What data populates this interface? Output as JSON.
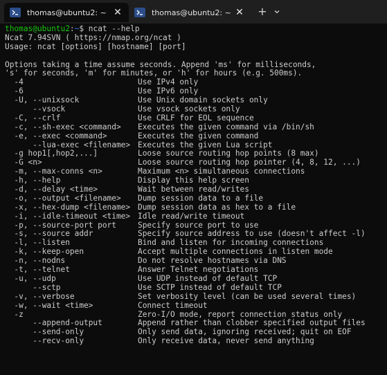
{
  "tabs": [
    {
      "title": "thomas@ubuntu2: ~",
      "close_glyph": "✕",
      "icon": "linux-terminal-icon",
      "active": true
    },
    {
      "title": "thomas@ubuntu2: ~",
      "close_glyph": "✕",
      "icon": "linux-terminal-icon",
      "active": false
    }
  ],
  "titlebar": {
    "new_tab_glyph": "+",
    "dropdown_icon": "chevron-down-icon"
  },
  "terminal": {
    "prompt": {
      "user_host": "thomas@ubuntu2",
      "separator": ":",
      "path": "~",
      "symbol": "$",
      "command": "ncat --help"
    },
    "header_lines": [
      "Ncat 7.94SVN ( https://nmap.org/ncat )",
      "Usage: ncat [options] [hostname] [port]"
    ],
    "intro_lines": [
      "Options taking a time assume seconds. Append 'ms' for milliseconds,",
      "'s' for seconds, 'm' for minutes, or 'h' for hours (e.g. 500ms)."
    ],
    "options": [
      {
        "opt": "  -4",
        "desc": "Use IPv4 only"
      },
      {
        "opt": "  -6",
        "desc": "Use IPv6 only"
      },
      {
        "opt": "  -U, --unixsock",
        "desc": "Use Unix domain sockets only"
      },
      {
        "opt": "      --vsock",
        "desc": "Use vsock sockets only"
      },
      {
        "opt": "  -C, --crlf",
        "desc": "Use CRLF for EOL sequence"
      },
      {
        "opt": "  -c, --sh-exec <command>",
        "desc": "Executes the given command via /bin/sh"
      },
      {
        "opt": "  -e, --exec <command>",
        "desc": "Executes the given command"
      },
      {
        "opt": "      --lua-exec <filename>",
        "desc": "Executes the given Lua script"
      },
      {
        "opt": "  -g hop1[,hop2,...]",
        "desc": "Loose source routing hop points (8 max)"
      },
      {
        "opt": "  -G <n>",
        "desc": "Loose source routing hop pointer (4, 8, 12, ...)"
      },
      {
        "opt": "  -m, --max-conns <n>",
        "desc": "Maximum <n> simultaneous connections"
      },
      {
        "opt": "  -h, --help",
        "desc": "Display this help screen"
      },
      {
        "opt": "  -d, --delay <time>",
        "desc": "Wait between read/writes"
      },
      {
        "opt": "  -o, --output <filename>",
        "desc": "Dump session data to a file"
      },
      {
        "opt": "  -x, --hex-dump <filename>",
        "desc": "Dump session data as hex to a file"
      },
      {
        "opt": "  -i, --idle-timeout <time>",
        "desc": "Idle read/write timeout"
      },
      {
        "opt": "  -p, --source-port port",
        "desc": "Specify source port to use"
      },
      {
        "opt": "  -s, --source addr",
        "desc": "Specify source address to use (doesn't affect -l)"
      },
      {
        "opt": "  -l, --listen",
        "desc": "Bind and listen for incoming connections"
      },
      {
        "opt": "  -k, --keep-open",
        "desc": "Accept multiple connections in listen mode"
      },
      {
        "opt": "  -n, --nodns",
        "desc": "Do not resolve hostnames via DNS"
      },
      {
        "opt": "  -t, --telnet",
        "desc": "Answer Telnet negotiations"
      },
      {
        "opt": "  -u, --udp",
        "desc": "Use UDP instead of default TCP"
      },
      {
        "opt": "      --sctp",
        "desc": "Use SCTP instead of default TCP"
      },
      {
        "opt": "  -v, --verbose",
        "desc": "Set verbosity level (can be used several times)"
      },
      {
        "opt": "  -w, --wait <time>",
        "desc": "Connect timeout"
      },
      {
        "opt": "  -z",
        "desc": "Zero-I/O mode, report connection status only"
      },
      {
        "opt": "      --append-output",
        "desc": "Append rather than clobber specified output files"
      },
      {
        "opt": "      --send-only",
        "desc": "Only send data, ignoring received; quit on EOF"
      },
      {
        "opt": "      --recv-only",
        "desc": "Only receive data, never send anything"
      }
    ]
  },
  "colors": {
    "background": "#0c0c0c",
    "titlebar": "#1f1f1f",
    "text": "#cccccc",
    "prompt_user": "#16c60c",
    "prompt_path": "#3b78ff"
  }
}
